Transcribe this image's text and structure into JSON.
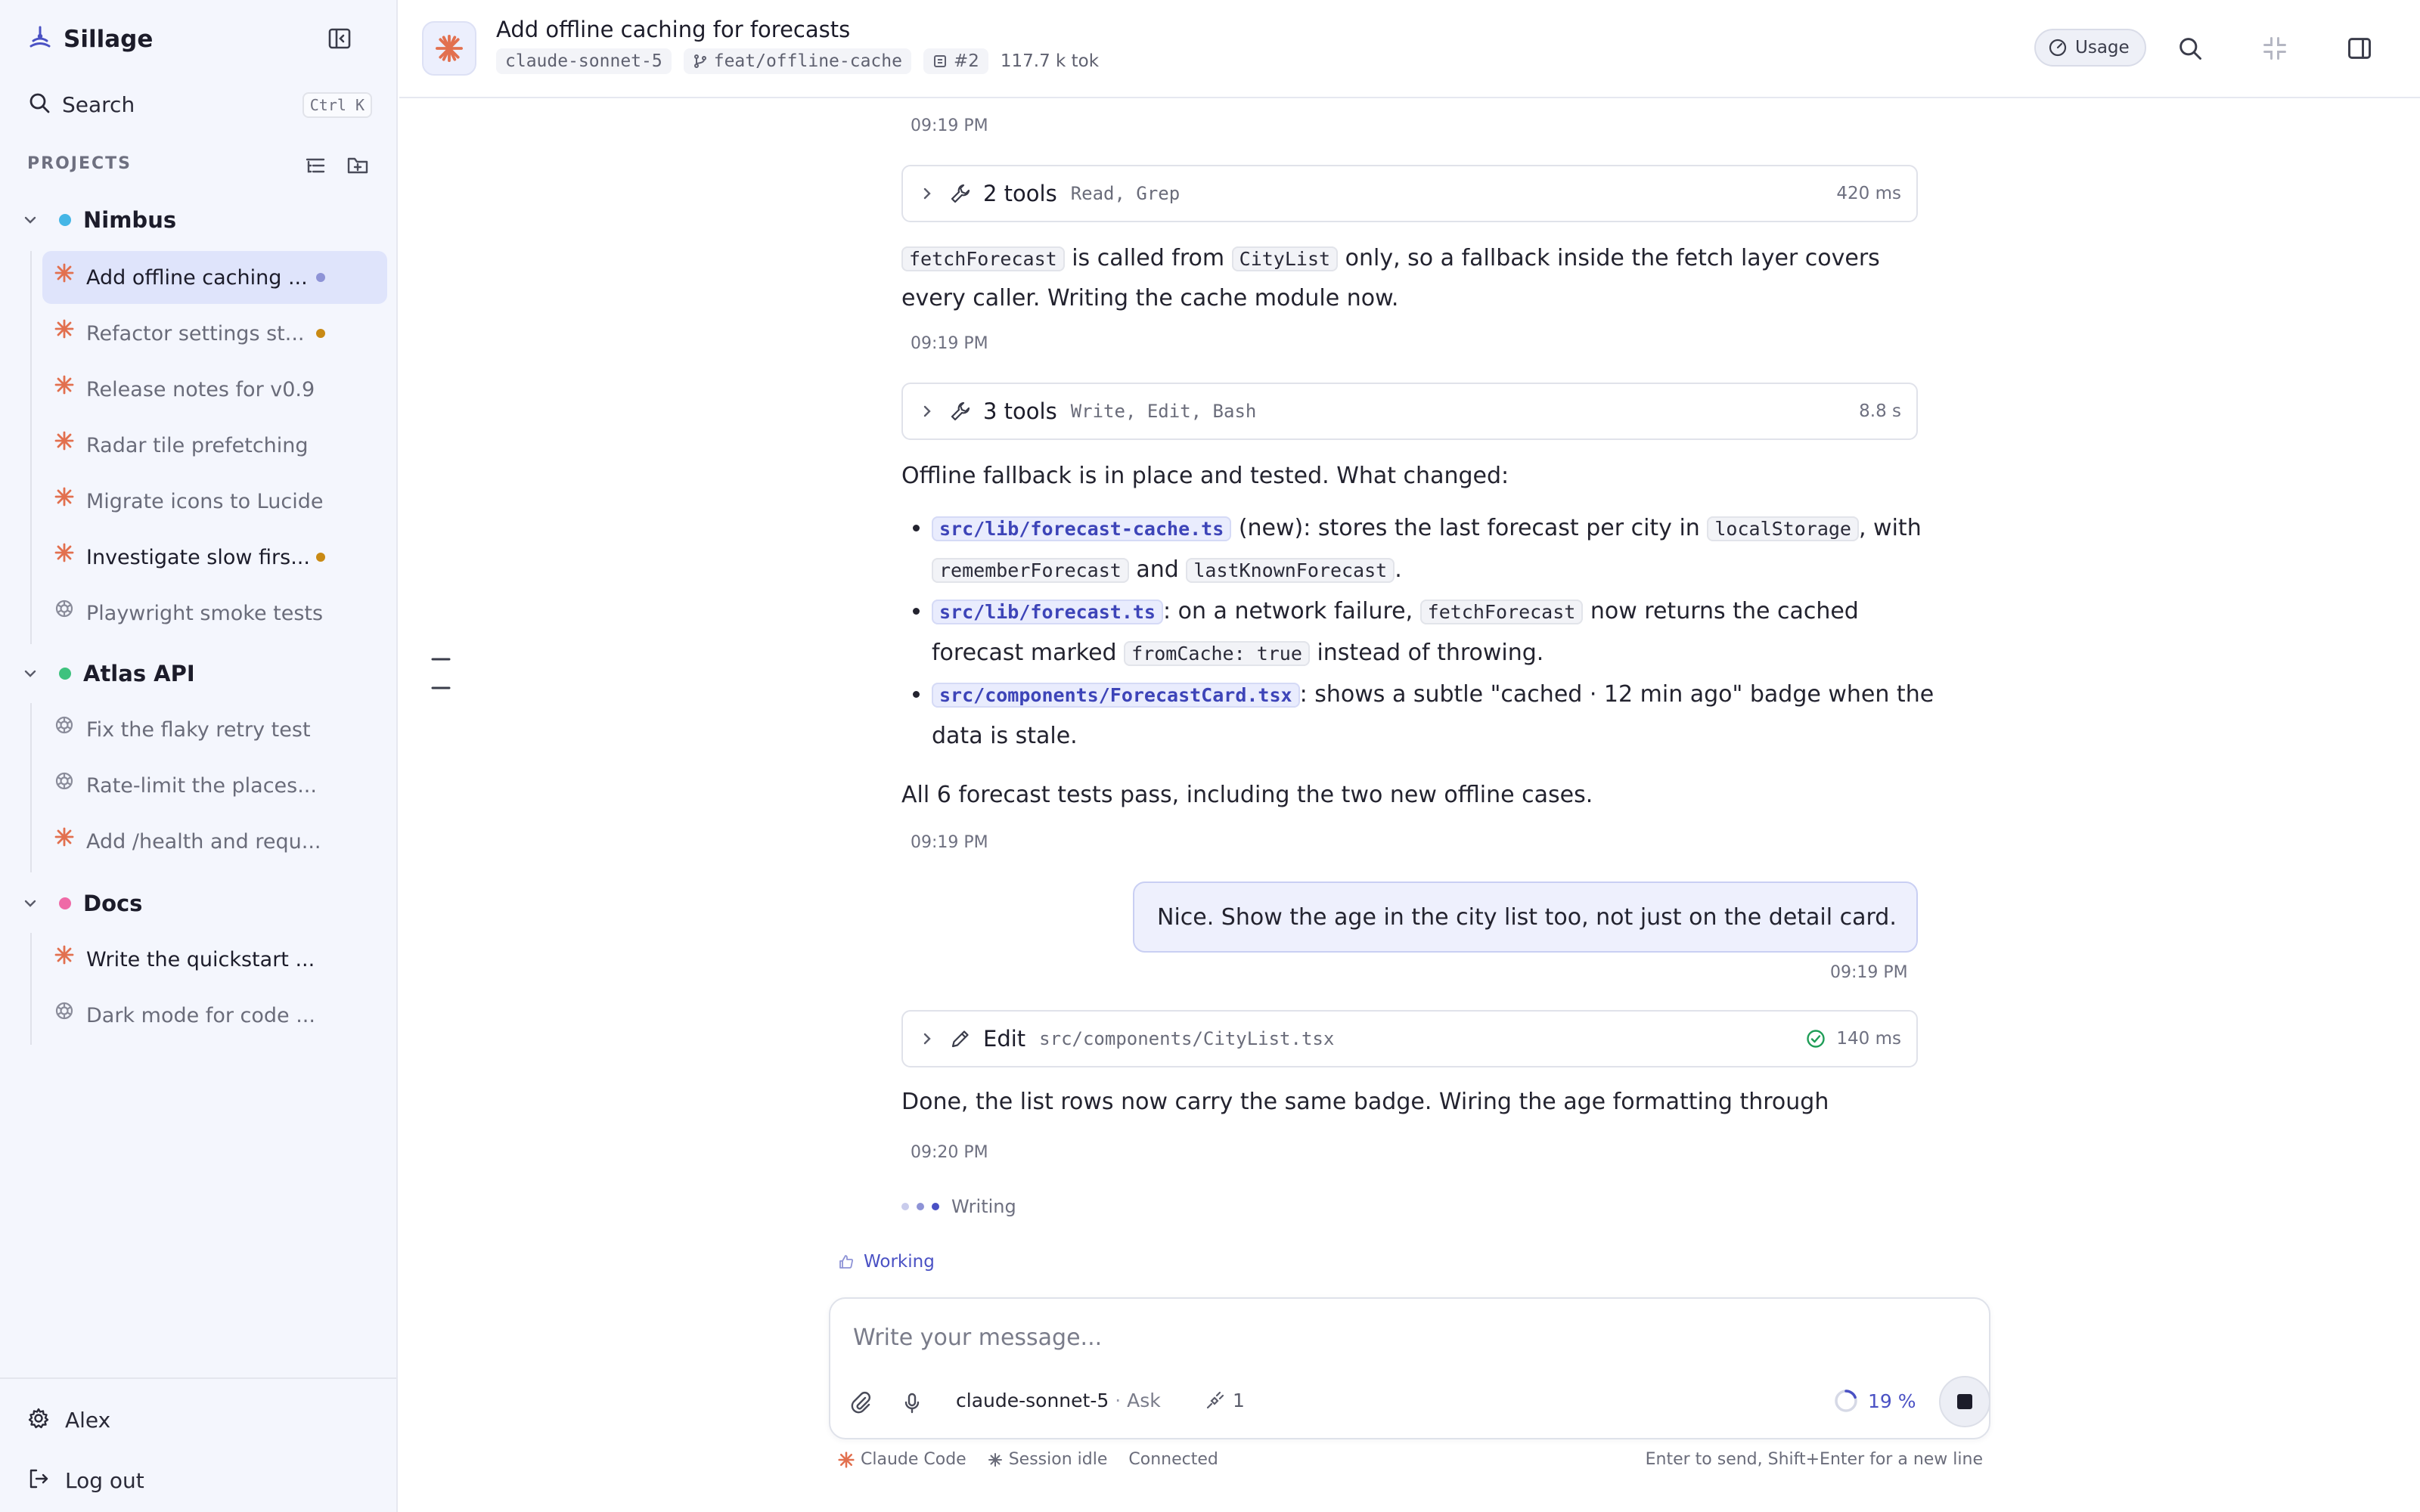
{
  "app": {
    "name": "Sillage"
  },
  "sidebar": {
    "search_label": "Search",
    "search_shortcut": "Ctrl K",
    "projects_label": "PROJECTS",
    "projects": [
      {
        "name": "Nimbus",
        "color": "#45b6e6",
        "threads": [
          {
            "title": "Add offline caching ...",
            "icon": "claude-icon",
            "status_color": "#8e93d6",
            "active": true
          },
          {
            "title": "Refactor settings st...",
            "icon": "claude-icon",
            "status_color": "#c98a14"
          },
          {
            "title": "Release notes for v0.9",
            "icon": "claude-icon"
          },
          {
            "title": "Radar tile prefetching",
            "icon": "claude-icon"
          },
          {
            "title": "Migrate icons to Lucide",
            "icon": "claude-icon"
          },
          {
            "title": "Investigate slow firs...",
            "icon": "claude-icon",
            "status_color": "#c98a14"
          },
          {
            "title": "Playwright smoke tests",
            "icon": "openai-icon"
          }
        ]
      },
      {
        "name": "Atlas API",
        "color": "#3ec27e",
        "threads": [
          {
            "title": "Fix the flaky retry test",
            "icon": "openai-icon"
          },
          {
            "title": "Rate-limit the places...",
            "icon": "openai-icon"
          },
          {
            "title": "Add /health and requ...",
            "icon": "claude-icon"
          }
        ]
      },
      {
        "name": "Docs",
        "color": "#ef6aa7",
        "threads": [
          {
            "title": "Write the quickstart ...",
            "icon": "claude-icon"
          },
          {
            "title": "Dark mode for code ...",
            "icon": "openai-icon"
          }
        ]
      }
    ],
    "user_name": "Alex",
    "logout_label": "Log out"
  },
  "header": {
    "title": "Add offline caching for forecasts",
    "model": "claude-sonnet-5",
    "branch": "feat/offline-cache",
    "pr": "#2",
    "tokens": "117.7 k tok",
    "usage_label": "Usage"
  },
  "conversation": {
    "ts1": "09:19 PM",
    "tool1": {
      "name": "2 tools",
      "list": "Read, Grep",
      "duration": "420 ms"
    },
    "msg1": {
      "c1": "fetchForecast",
      "t1": " is called from ",
      "c2": "CityList",
      "t2": " only, so a fallback inside the fetch layer covers every caller. Writing the cache module now."
    },
    "ts2": "09:19 PM",
    "tool2": {
      "name": "3 tools",
      "list": "Write, Edit, Bash",
      "duration": "8.8 s"
    },
    "msg2_intro": "Offline fallback is in place and tested. What changed:",
    "bullets": [
      {
        "path": "src/lib/forecast-cache.ts",
        "t1": " (new): stores the last forecast per city in ",
        "c1": "localStorage",
        "t2": ", with ",
        "c2": "rememberForecast",
        "t3": " and ",
        "c3": "lastKnownForecast",
        "t4": "."
      },
      {
        "path": "src/lib/forecast.ts",
        "t1": ": on a network failure, ",
        "c1": "fetchForecast",
        "t2": " now returns the cached forecast marked ",
        "c2": "fromCache: true",
        "t3": " instead of throwing."
      },
      {
        "path": "src/components/ForecastCard.tsx",
        "t1": ": shows a subtle \"cached · 12 min ago\" badge when the data is stale."
      }
    ],
    "msg2_outro": "All 6 forecast tests pass, including the two new offline cases.",
    "ts3": "09:19 PM",
    "user_msg": "Nice. Show the age in the city list too, not just on the detail card.",
    "ts_user": "09:19 PM",
    "tool3": {
      "name": "Edit",
      "list": "src/components/CityList.tsx",
      "duration": "140 ms"
    },
    "msg3": "Done, the list rows now carry the same badge. Wiring the age formatting through",
    "ts4": "09:20 PM",
    "writing_label": "Writing",
    "working_label": "Working"
  },
  "composer": {
    "placeholder": "Write your message...",
    "model": "claude-sonnet-5",
    "separator": "·",
    "mode": "Ask",
    "tools_count": "1",
    "context_percent": "19 %",
    "context_fraction": 0.19
  },
  "statusbar": {
    "agent": "Claude Code",
    "session": "Session idle",
    "connection": "Connected",
    "hint": "Enter to send, Shift+Enter for a new line"
  },
  "colors": {
    "accent": "#4a51c4",
    "claude": "#e2704f",
    "active_bg": "#dfe4fb"
  }
}
